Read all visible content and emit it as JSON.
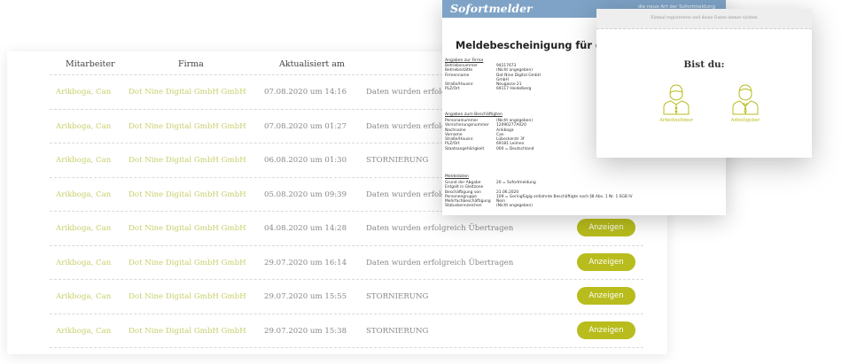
{
  "table": {
    "headers": [
      "Mitarbeiter",
      "Firma",
      "Aktualisiert am"
    ],
    "rows": [
      {
        "name": "Arikboga, Can",
        "firm": "Dot Nine Digital GmbH GmbH",
        "date": "07.08.2020 um 14:16",
        "status": "Daten wurden erfolgre"
      },
      {
        "name": "Arikboga, Can",
        "firm": "Dot Nine Digital GmbH GmbH",
        "date": "07.08.2020 um 01:27",
        "status": "Daten wurden erfolgre"
      },
      {
        "name": "Arikboga, Can",
        "firm": "Dot Nine Digital GmbH GmbH",
        "date": "06.08.2020 um 01:30",
        "status": "STORNIERUNG"
      },
      {
        "name": "Arikboga, Can",
        "firm": "Dot Nine Digital GmbH GmbH",
        "date": "05.08.2020 um 09:39",
        "status": "Daten wurden erfolgr"
      },
      {
        "name": "Arikboga, Can",
        "firm": "Dot Nine Digital GmbH GmbH",
        "date": "04.08.2020 um 14:28",
        "status": "Daten wurden erfolgreich Übertragen",
        "action": "Anzeigen"
      },
      {
        "name": "Arikboga, Can",
        "firm": "Dot Nine Digital GmbH GmbH",
        "date": "29.07.2020 um 16:14",
        "status": "Daten wurden erfolgreich Übertragen",
        "action": "Anzeigen"
      },
      {
        "name": "Arikboga, Can",
        "firm": "Dot Nine Digital GmbH GmbH",
        "date": "29.07.2020 um 15:55",
        "status": "STORNIERUNG",
        "action": "Anzeigen"
      },
      {
        "name": "Arikboga, Can",
        "firm": "Dot Nine Digital GmbH GmbH",
        "date": "29.07.2020 um 15:38",
        "status": "STORNIERUNG",
        "action": "Anzeigen"
      }
    ]
  },
  "document": {
    "brand": "Sofortmelder",
    "tagline": "die neue Art der Sofortmeldung",
    "title": "Meldebescheinigung für den Arbeitg",
    "firm_section": {
      "title": "Angaben zur Firma",
      "rows": [
        {
          "k": "Betriebsnummer",
          "v": "94217673"
        },
        {
          "k": "Betriebsstätte",
          "v": "(Nicht angegeben)"
        },
        {
          "k": "Firmenname",
          "v": "Dot Nine Digital GmbH"
        },
        {
          "k": "",
          "v": "GmbH"
        },
        {
          "k": "Straße/Hausnr.",
          "v": "Neugasse 21"
        },
        {
          "k": "PLZ/Ort",
          "v": "69117 Heidelberg"
        }
      ]
    },
    "employee_section": {
      "title": "Angaben zum Beschäftigten",
      "rows": [
        {
          "k": "Personalnummer",
          "v": "(Nicht angegeben)"
        },
        {
          "k": "Versicherungsnummer",
          "v": "12090277A020"
        },
        {
          "k": "Nachname",
          "v": "Arikboga"
        },
        {
          "k": "Vorname",
          "v": "Can"
        },
        {
          "k": "Straße/Hausnr.",
          "v": "Lübeckerstr 3f"
        },
        {
          "k": "PLZ/Ort",
          "v": "69181 Leimen"
        },
        {
          "k": "Staatsangehörigkeit",
          "v": "000 = Deutschland"
        }
      ]
    },
    "report_section": {
      "title": "Meldedaten",
      "rows": [
        {
          "k": "Grund der Abgabe",
          "v": "20 = Sofortmeldung"
        },
        {
          "k": "Entgelt in Gleitzone",
          "v": ""
        },
        {
          "k": "Beschäftigung von",
          "v": "21.06.2020"
        },
        {
          "k": "Personengruppe",
          "v": "109 = Geringfügig entlohnte Beschäftigte nach §8 Abs. 1 Nr. 1 SGB IV"
        },
        {
          "k": "Mehrfachbeschäftigung",
          "v": "Nein"
        },
        {
          "k": "Statuskennzeichen",
          "v": "(Nicht angegeben)"
        }
      ]
    }
  },
  "popup": {
    "banner": "Einmal registrieren und deine Daten immer sichten",
    "title": "Bist du:",
    "options": [
      {
        "label": "Arbeitnehmer",
        "icon": "employee-icon"
      },
      {
        "label": "Arbeitgeber",
        "icon": "employer-icon"
      }
    ]
  },
  "colors": {
    "accent": "#b8bc1c",
    "link": "#c8cf6a",
    "doc_header": "#7ea3c6"
  }
}
